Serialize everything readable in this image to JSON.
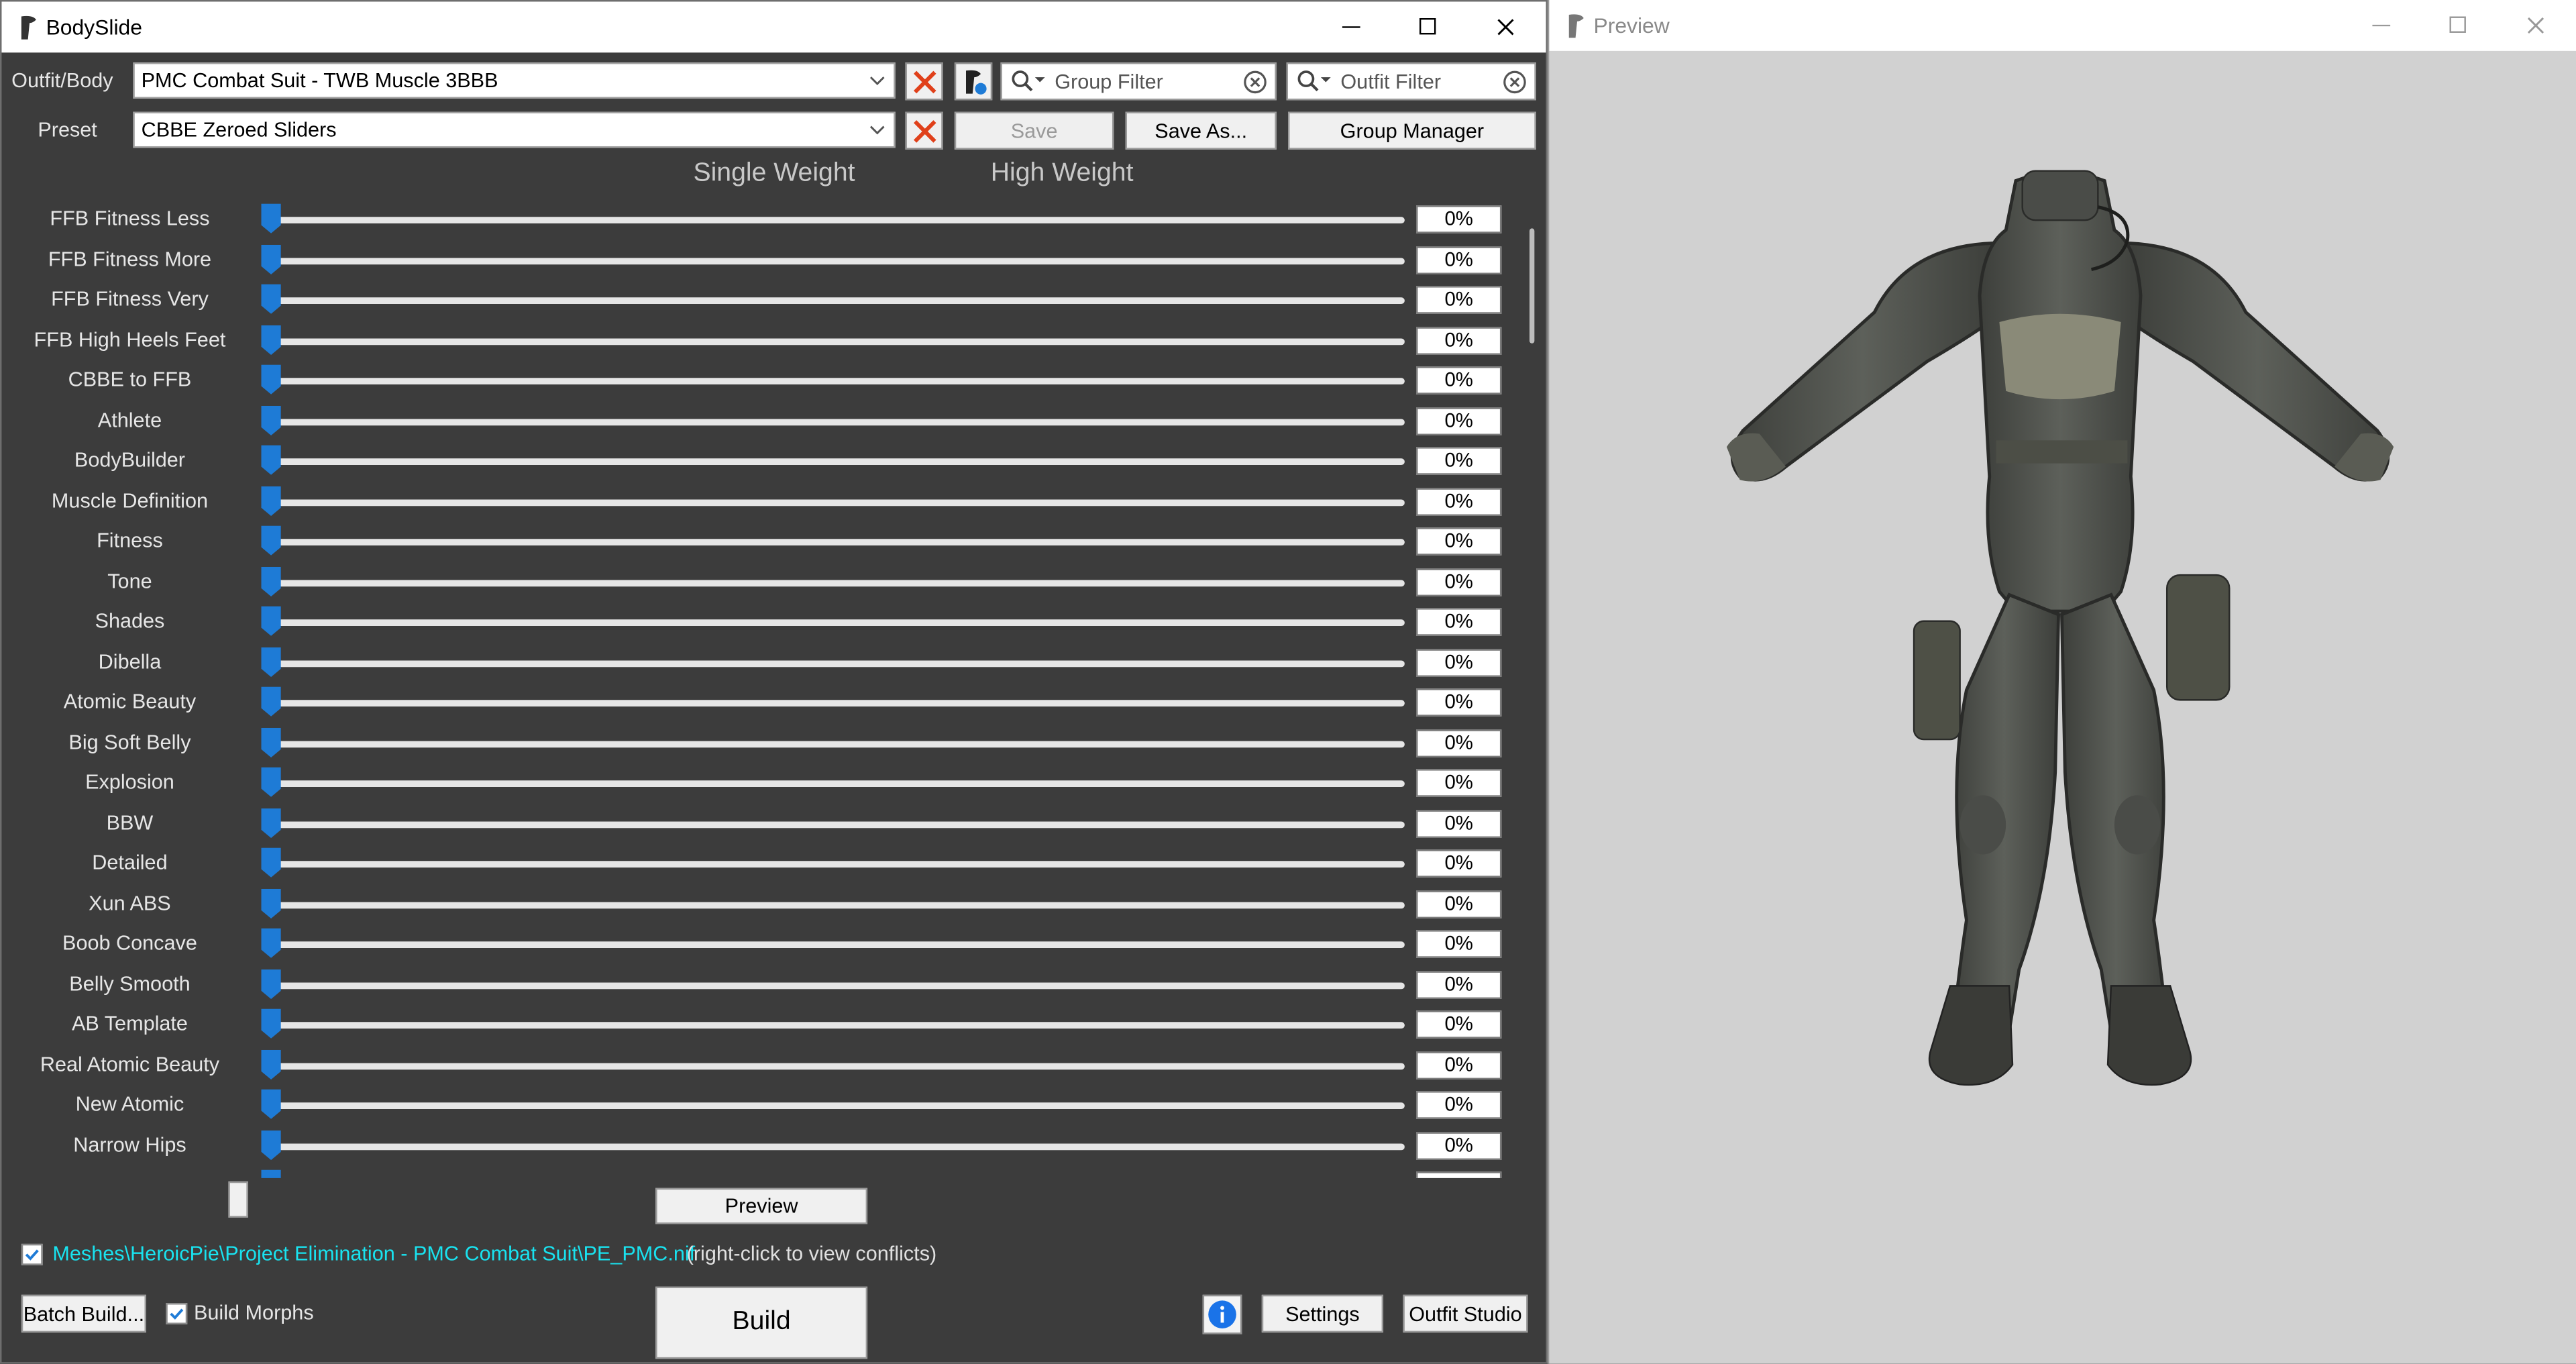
{
  "main_window": {
    "title": "BodySlide",
    "outfit_label": "Outfit/Body",
    "outfit_value": "PMC Combat Suit - TWB Muscle 3BBB",
    "preset_label": "Preset",
    "preset_value": "CBBE Zeroed Sliders",
    "group_filter_placeholder": "Group Filter",
    "outfit_filter_placeholder": "Outfit Filter",
    "save_label": "Save",
    "save_as_label": "Save As...",
    "group_manager_label": "Group Manager",
    "single_weight_label": "Single Weight",
    "high_weight_label": "High Weight",
    "preview_label": "Preview",
    "file_path": "Meshes\\HeroicPie\\Project Elimination - PMC Combat Suit\\PE_PMC.nif",
    "conflicts_note": "(right-click to view conflicts)",
    "batch_build_label": "Batch Build...",
    "build_morphs_label": "Build Morphs",
    "build_label": "Build",
    "settings_label": "Settings",
    "outfit_studio_label": "Outfit Studio"
  },
  "sliders": [
    {
      "name": "FFB Fitness Less",
      "value": "0%"
    },
    {
      "name": "FFB Fitness More",
      "value": "0%"
    },
    {
      "name": "FFB Fitness Very",
      "value": "0%"
    },
    {
      "name": "FFB High Heels Feet",
      "value": "0%"
    },
    {
      "name": "CBBE to FFB",
      "value": "0%"
    },
    {
      "name": "Athlete",
      "value": "0%"
    },
    {
      "name": "BodyBuilder",
      "value": "0%"
    },
    {
      "name": "Muscle Definition",
      "value": "0%"
    },
    {
      "name": "Fitness",
      "value": "0%"
    },
    {
      "name": "Tone",
      "value": "0%"
    },
    {
      "name": "Shades",
      "value": "0%"
    },
    {
      "name": "Dibella",
      "value": "0%"
    },
    {
      "name": "Atomic Beauty",
      "value": "0%"
    },
    {
      "name": "Big Soft Belly",
      "value": "0%"
    },
    {
      "name": "Explosion",
      "value": "0%"
    },
    {
      "name": "BBW",
      "value": "0%"
    },
    {
      "name": "Detailed",
      "value": "0%"
    },
    {
      "name": "Xun ABS",
      "value": "0%"
    },
    {
      "name": "Boob Concave",
      "value": "0%"
    },
    {
      "name": "Belly Smooth",
      "value": "0%"
    },
    {
      "name": "AB Template",
      "value": "0%"
    },
    {
      "name": "Real Atomic Beauty",
      "value": "0%"
    },
    {
      "name": "New Atomic",
      "value": "0%"
    },
    {
      "name": "Narrow Hips",
      "value": "0%"
    }
  ],
  "preview_window": {
    "title": "Preview"
  },
  "colors": {
    "accent": "#1e7bd6",
    "link": "#19e3f0",
    "clear_x": "#e0401a",
    "info": "#1a73e8"
  }
}
